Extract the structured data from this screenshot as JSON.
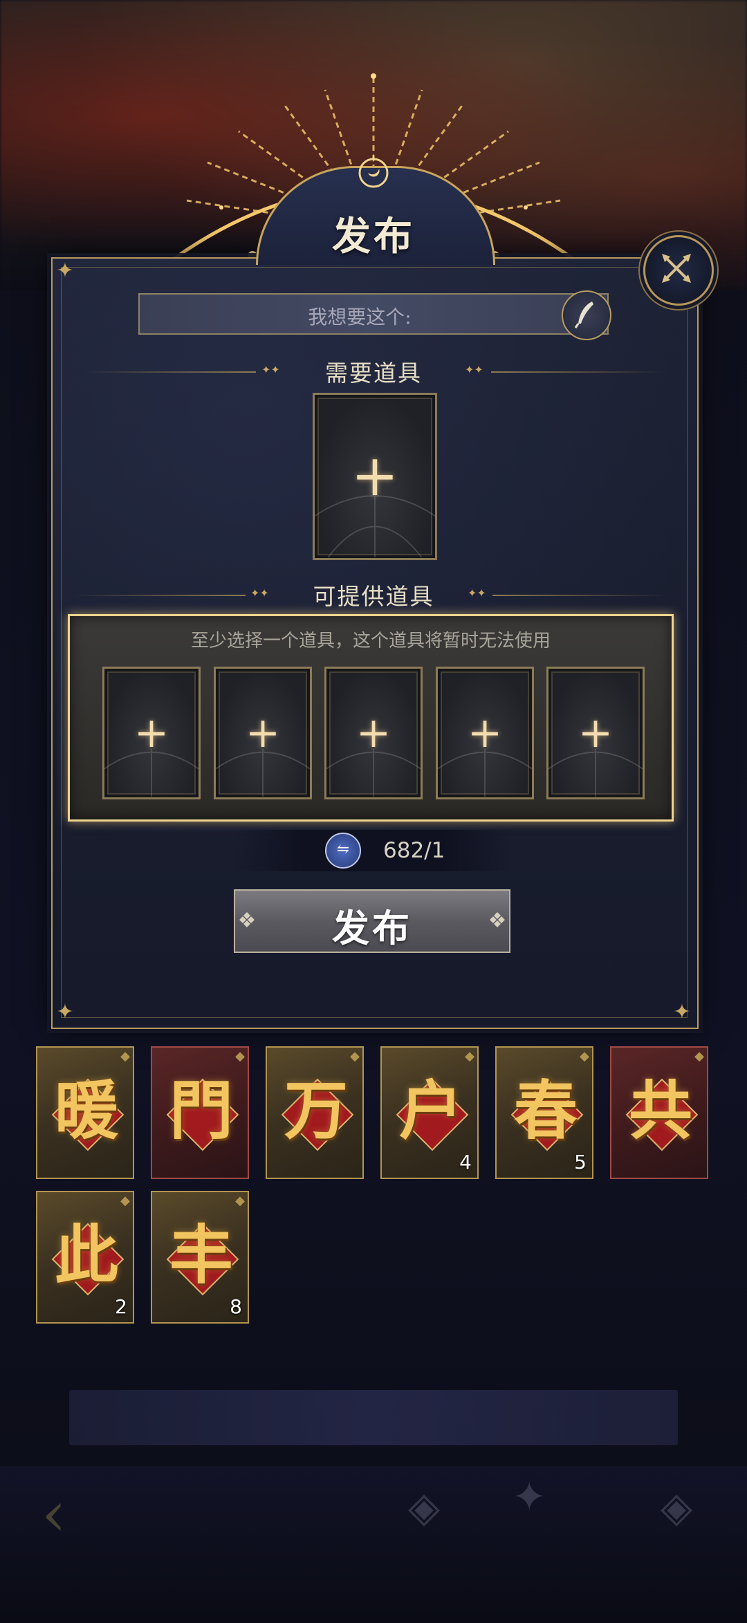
{
  "dialog": {
    "title": "发布",
    "wish_placeholder": "我想要这个:",
    "need_section": "需要道具",
    "offer_section": "可提供道具",
    "offer_hint": "至少选择一个道具，这个道具将暂时无法使用",
    "cost_value": "682/1",
    "publish_label": "发布"
  },
  "inventory": [
    {
      "glyph": "暖",
      "style": "gold",
      "count": ""
    },
    {
      "glyph": "門",
      "style": "red",
      "count": ""
    },
    {
      "glyph": "万",
      "style": "gold",
      "count": ""
    },
    {
      "glyph": "户",
      "style": "gold",
      "count": "4"
    },
    {
      "glyph": "春",
      "style": "gold",
      "count": "5"
    },
    {
      "glyph": "共",
      "style": "red",
      "count": ""
    },
    {
      "glyph": "此",
      "style": "gold",
      "count": "2"
    },
    {
      "glyph": "丰",
      "style": "gold",
      "count": "8"
    }
  ],
  "colors": {
    "accent_gold": "#c9a55c",
    "panel_bg": "#1a1f30",
    "offer_glow": "#f0d58e"
  },
  "icons": [
    "moon-icon",
    "close-icon",
    "quill-icon",
    "plus-icon",
    "exchange-icon",
    "back-arrow-icon"
  ]
}
